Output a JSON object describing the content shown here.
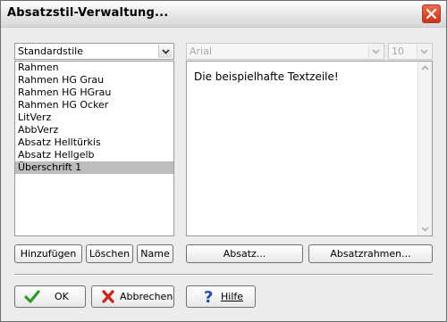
{
  "window": {
    "title": "Absatzstil-Verwaltung..."
  },
  "style_group": {
    "selected": "Standardstile"
  },
  "styles_list": {
    "items": [
      "Rahmen",
      "Rahmen HG Grau",
      "Rahmen HG HGrau",
      "Rahmen HG Ocker",
      "LitVerz",
      "AbbVerz",
      "Absatz Helltürkis",
      "Absatz Hellgelb",
      "Überschrift 1"
    ],
    "selected_index": 8
  },
  "font": {
    "name": "Arial",
    "size": "10"
  },
  "preview": {
    "text": "Die beispielhafte Textzeile!"
  },
  "buttons": {
    "add": "Hinzufügen",
    "delete": "Löschen",
    "name": "Name",
    "paragraph": "Absatz...",
    "paragraph_frame": "Absatzrahmen...",
    "ok": "OK",
    "cancel": "Abbrechen",
    "help": "Hilfe"
  },
  "icons": {
    "close": "close-icon",
    "ok": "checkmark-icon",
    "cancel": "red-x-icon",
    "help": "question-mark-icon"
  },
  "colors": {
    "ok_check": "#2e9a2e",
    "cancel_x": "#c8281e",
    "help_question": "#1f4fa8",
    "close_button": "#d6452a",
    "selected_item_bg": "#bdbdbd"
  }
}
